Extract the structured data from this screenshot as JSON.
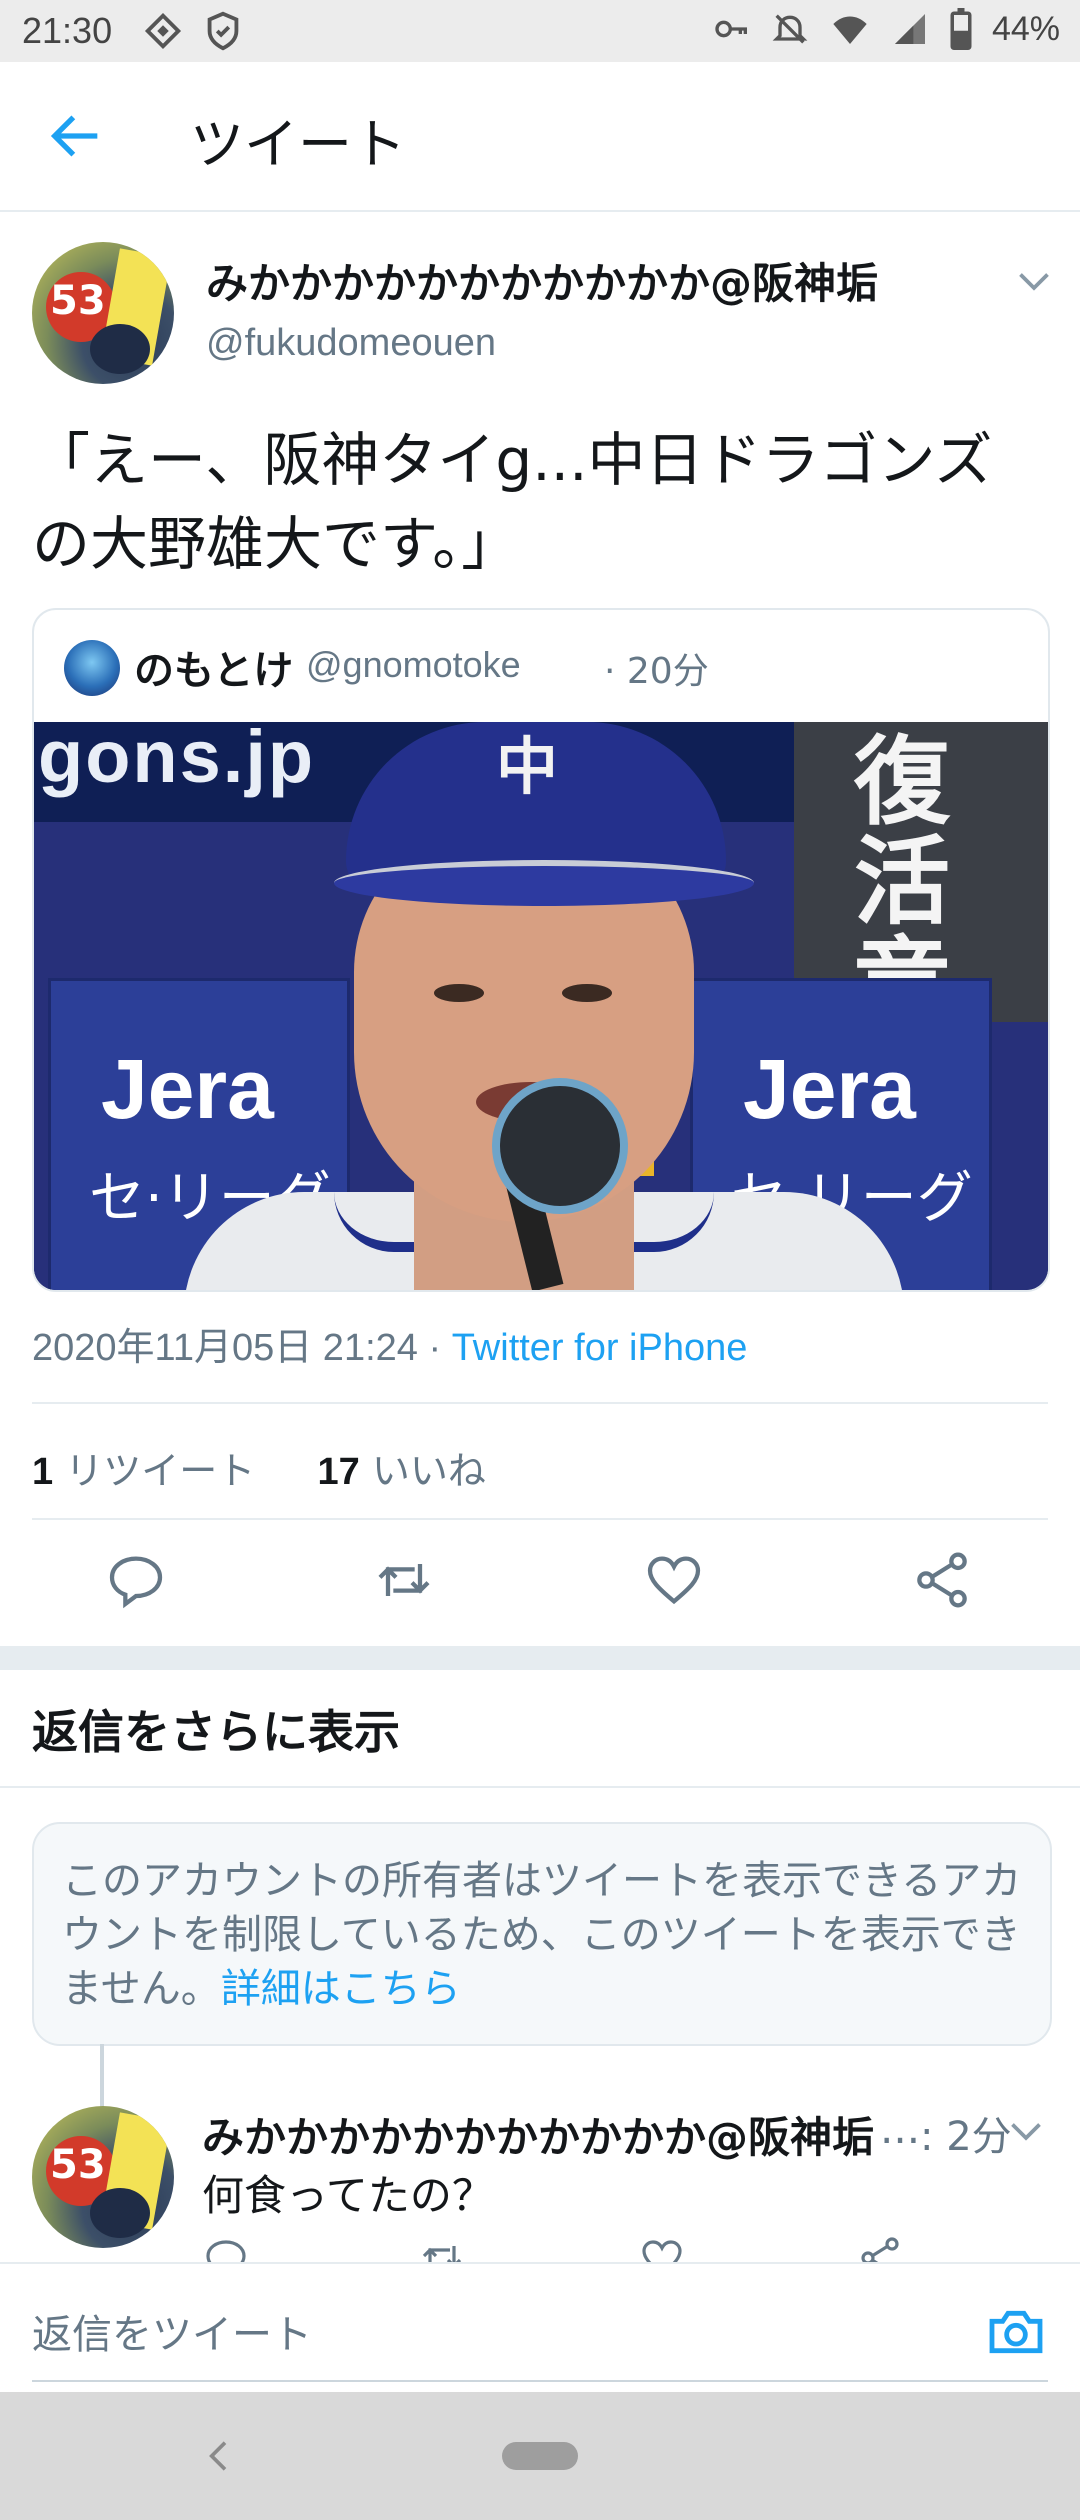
{
  "status_bar": {
    "time": "21:30",
    "battery": "44%",
    "icons": [
      "cast-icon",
      "shield-icon",
      "key-icon",
      "mute-icon",
      "wifi-icon",
      "signal-icon",
      "battery-icon"
    ]
  },
  "header": {
    "title": "ツイート",
    "back_icon": "arrow-left-icon",
    "accent_color": "#1da1f2"
  },
  "tweet": {
    "author_name": "みかかかかかかかかかかか@阪神垢",
    "author_handle": "@fukudomeouen",
    "avatar_text": "53",
    "text_line1": "「えー、阪神タイg...中日ドラゴンズ",
    "text_line2": "の大野雄大です。」",
    "timestamp": "2020年11月05日 21:24",
    "separator": " · ",
    "client": "Twitter for iPhone",
    "retweet_count": "1",
    "retweet_label": "リツイート",
    "like_count": "17",
    "like_label": "いいね"
  },
  "quoted_tweet": {
    "author_name": "のもとけ",
    "author_handle": "@gnomotoke",
    "time": "· 20分",
    "media": {
      "banner_text": "gons.jp",
      "kanji_text": "復活竜",
      "panel_brand": "Jera",
      "panel_sub": "セ·リーグ",
      "cap_logo": "中"
    }
  },
  "section": {
    "more_replies": "返信をさらに表示"
  },
  "notice": {
    "text": "このアカウントの所有者はツイートを表示できるアカウントを制限しているため、このツイートを表示できません。",
    "link": "詳細はこちら"
  },
  "reply": {
    "author_name": "みかかかかかかかかかかか@阪神垢",
    "ellipsis": "...",
    "time": ": 2分",
    "text": "何食ってたの？"
  },
  "composer": {
    "placeholder": "返信をツイート",
    "camera_icon": "camera-icon"
  }
}
